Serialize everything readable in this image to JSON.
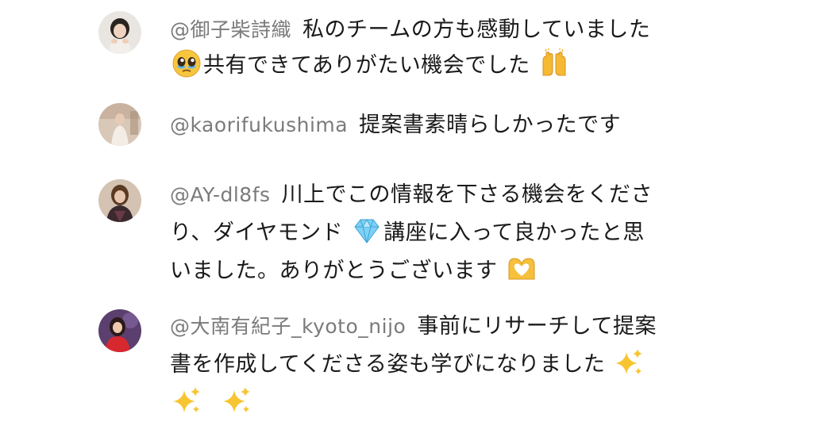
{
  "comments": [
    {
      "author": "@御子柴詩織",
      "text_1": "私のチームの方も感動していました",
      "text_2": "共有できてありがたい機会でした",
      "avatar_icon": "user-avatar",
      "emojis": [
        "pleading-face-emoji",
        "raising-hands-emoji"
      ]
    },
    {
      "author": "@kaorifukushima",
      "text_1": "提案書素晴らしかったです",
      "avatar_icon": "user-avatar"
    },
    {
      "author": "@AY-dl8fs",
      "text_1": "川上でこの情報を下さる機会をくださ",
      "text_2": "り、ダイヤモンド",
      "text_3": "講座に入って良かったと思",
      "text_4": "いました。ありがとうございます",
      "avatar_icon": "user-avatar",
      "emojis": [
        "gem-emoji",
        "heart-hands-emoji"
      ]
    },
    {
      "author": "@大南有紀子_kyoto_nijo",
      "text_1": "事前にリサーチして提案",
      "text_2": "書を作成してくださる姿も学びになりました",
      "avatar_icon": "user-avatar",
      "emojis": [
        "sparkles-emoji",
        "sparkles-emoji",
        "sparkles-emoji"
      ]
    }
  ],
  "colors": {
    "author": "#7b7b7b",
    "text": "#1a1a1a",
    "background": "#ffffff"
  }
}
